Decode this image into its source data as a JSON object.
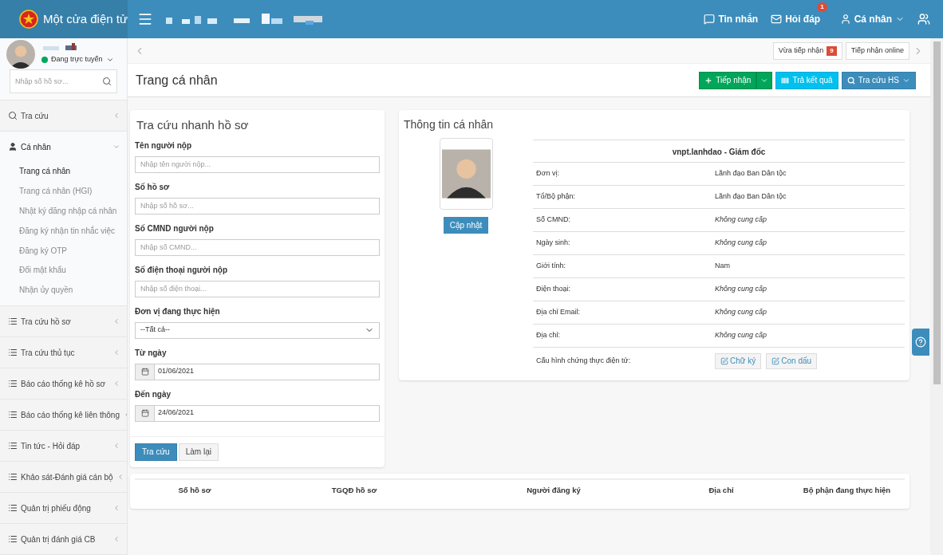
{
  "brand": {
    "title": "Một cửa điện tử"
  },
  "topnav": [
    {
      "kind": "message",
      "label": "Tin nhắn"
    },
    {
      "kind": "mail",
      "label": "Hỏi đáp",
      "badge": "1"
    },
    {
      "kind": "user",
      "label": "Cá nhân",
      "caret": true
    }
  ],
  "user": {
    "status": "Đang trực tuyến",
    "online": true
  },
  "sidebar": {
    "search_placeholder": "Nhập số hồ sơ...",
    "items": [
      {
        "label": "Tra cứu",
        "expanded": false
      },
      {
        "label": "Cá nhân",
        "expanded": true,
        "children": [
          {
            "label": "Trang cá nhân",
            "selected": true
          },
          {
            "label": "Trang cá nhân (HGI)",
            "selected": false
          },
          {
            "label": "Nhật ký đăng nhập cá nhân",
            "selected": false
          },
          {
            "label": "Đăng ký nhận tin nhắc việc",
            "selected": false
          },
          {
            "label": "Đăng ký OTP",
            "selected": false
          },
          {
            "label": "Đổi mật khẩu",
            "selected": false
          },
          {
            "label": "Nhận ủy quyền",
            "selected": false
          }
        ]
      },
      {
        "label": "Tra cứu hồ sơ",
        "expanded": false
      },
      {
        "label": "Tra cứu thủ tục",
        "expanded": false
      },
      {
        "label": "Báo cáo thống kê hồ sơ",
        "expanded": false
      },
      {
        "label": "Báo cáo thống kê liên thông",
        "expanded": false
      },
      {
        "label": "Tin tức - Hỏi đáp",
        "expanded": false
      },
      {
        "label": "Khảo sát-Đánh giá cán bộ",
        "expanded": false
      },
      {
        "label": "Quản trị phiếu động",
        "expanded": false
      },
      {
        "label": "Quản trị đánh giá CB",
        "expanded": false
      }
    ]
  },
  "quick_tabs": [
    {
      "label": "Vừa tiếp nhận",
      "badge": "9"
    },
    {
      "label": "Tiếp nhận online"
    }
  ],
  "page_title": "Trang cá nhân",
  "actions": [
    {
      "kind": "success",
      "label": "Tiếp nhận",
      "split": true
    },
    {
      "kind": "info",
      "label": "Trả kết quả"
    },
    {
      "kind": "primary",
      "label": "Tra cứu HS",
      "caret": true
    }
  ],
  "search_panel": {
    "title": "Tra cứu nhanh hồ sơ",
    "fields": [
      {
        "kind": "text",
        "label": "Tên người nộp",
        "placeholder": "Nhập tên người nộp..."
      },
      {
        "kind": "text",
        "label": "Số hồ sơ",
        "placeholder": "Nhập số hồ sơ..."
      },
      {
        "kind": "text",
        "label": "Số CMND người nộp",
        "placeholder": "Nhập số CMND..."
      },
      {
        "kind": "text",
        "label": "Số điện thoại người nộp",
        "placeholder": "Nhập số điện thoại..."
      },
      {
        "kind": "select",
        "label": "Đơn vị đang thực hiện",
        "value": "--Tất cả--"
      },
      {
        "kind": "date",
        "label": "Từ ngày",
        "value": "01/06/2021"
      },
      {
        "kind": "date",
        "label": "Đến ngày",
        "value": "24/06/2021"
      }
    ],
    "buttons": [
      {
        "kind": "primary",
        "label": "Tra cứu"
      },
      {
        "kind": "default",
        "label": "Làm lại"
      }
    ]
  },
  "profile": {
    "title": "Thông tin cá nhân",
    "update_button": "Cập nhật",
    "heading": "vnpt.lanhdao - Giám đốc",
    "rows": [
      {
        "label": "Đơn vị:",
        "value": "Lãnh đạo Ban Dân tộc",
        "missing": false
      },
      {
        "label": "Tổ/Bộ phận:",
        "value": "Lãnh đạo Ban Dân tộc",
        "missing": false
      },
      {
        "label": "Số CMND:",
        "value": "Không cung cấp",
        "missing": true
      },
      {
        "label": "Ngày sinh:",
        "value": "Không cung cấp",
        "missing": true
      },
      {
        "label": "Giới tính:",
        "value": "Nam",
        "missing": false
      },
      {
        "label": "Điện thoại:",
        "value": "Không cung cấp",
        "missing": true
      },
      {
        "label": "Địa chỉ Email:",
        "value": "Không cung cấp",
        "missing": true
      },
      {
        "label": "Địa chỉ:",
        "value": "Không cung cấp",
        "missing": true
      }
    ],
    "signature_row": {
      "label": "Cấu hình chứng thực điện tử:",
      "buttons": [
        "Chữ ký",
        "Con dấu"
      ]
    }
  },
  "results_table": {
    "columns": [
      "Số hồ sơ",
      "TGQĐ hồ sơ",
      "Người đăng ký",
      "Địa chỉ",
      "Bộ phận đang thực hiện"
    ]
  }
}
